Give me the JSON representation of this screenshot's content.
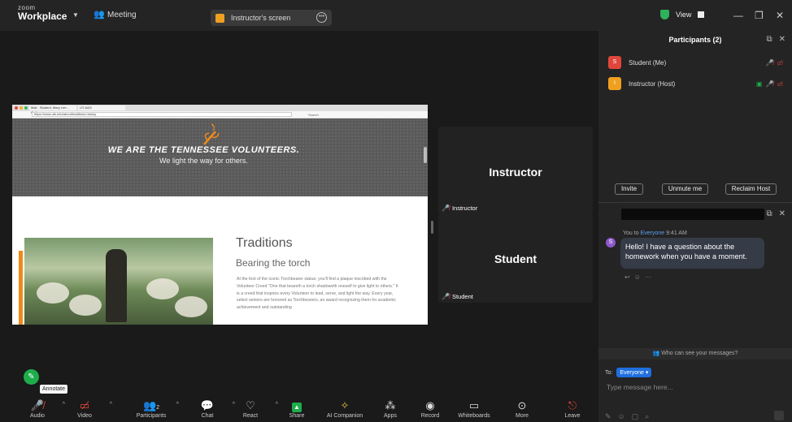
{
  "topbar": {
    "logo_line1": "zoom",
    "logo_line2": "Workplace",
    "meeting_label": "Meeting",
    "share_label": "Instructor's screen",
    "view_label": "View"
  },
  "shared_page": {
    "browser_tab1": "Mail - Student, Mary Lee - Outl...",
    "browser_tab2": "UT-A&G",
    "url": "https://www.utk.edu/about/traditions-history",
    "search_placeholder": "Search",
    "hero_title": "WE ARE THE TENNESSEE VOLUNTEERS.",
    "hero_subtitle": "We light the way for others.",
    "section_title": "Traditions",
    "section_subtitle": "Bearing the torch",
    "paragraph": "At the foot of the iconic Torchbearer statue, you'll find a plaque inscribed with the Volunteer Creed \"One that beareth a torch shadoweth oneself to give light to others.\" It is a creed that inspires every Volunteer to lead, serve, and light the way. Every year, select seniors are honored as Torchbearers, an award recognizing them for academic achievement and outstanding"
  },
  "tiles": [
    {
      "name": "Instructor",
      "label": "Instructor"
    },
    {
      "name": "Student",
      "label": "Student"
    }
  ],
  "participants_panel": {
    "title": "Participants (2)",
    "participants": [
      {
        "initial": "S",
        "name": "Student (Me)",
        "color": "#e0463c"
      },
      {
        "initial": "I",
        "name": "Instructor (Host)",
        "color": "#f0a020"
      }
    ],
    "invite_label": "Invite",
    "unmute_label": "Unmute me",
    "reclaim_label": "Reclaim Host"
  },
  "chat": {
    "meta_prefix": "You to",
    "meta_recipient": "Everyone",
    "meta_time": "9:41 AM",
    "sender_initial": "S",
    "message": "Hello! I have a question about the homework when you have a moment.",
    "who_can_see": "Who can see your messages?",
    "to_label": "To:",
    "to_value": "Everyone",
    "input_placeholder": "Type message here..."
  },
  "annotate_label": "Annotate",
  "toolbar": {
    "audio": "Audio",
    "video": "Video",
    "participants": "Participants",
    "participants_count": "2",
    "chat": "Chat",
    "react": "React",
    "share": "Share",
    "ai": "AI Companion",
    "apps": "Apps",
    "record": "Record",
    "whiteboards": "Whiteboards",
    "more": "More",
    "leave": "Leave"
  },
  "colors": {
    "accent_green": "#1dad4b",
    "accent_blue": "#1f6fde",
    "mute_red": "#e0463c",
    "ut_orange": "#ef8a1a"
  }
}
